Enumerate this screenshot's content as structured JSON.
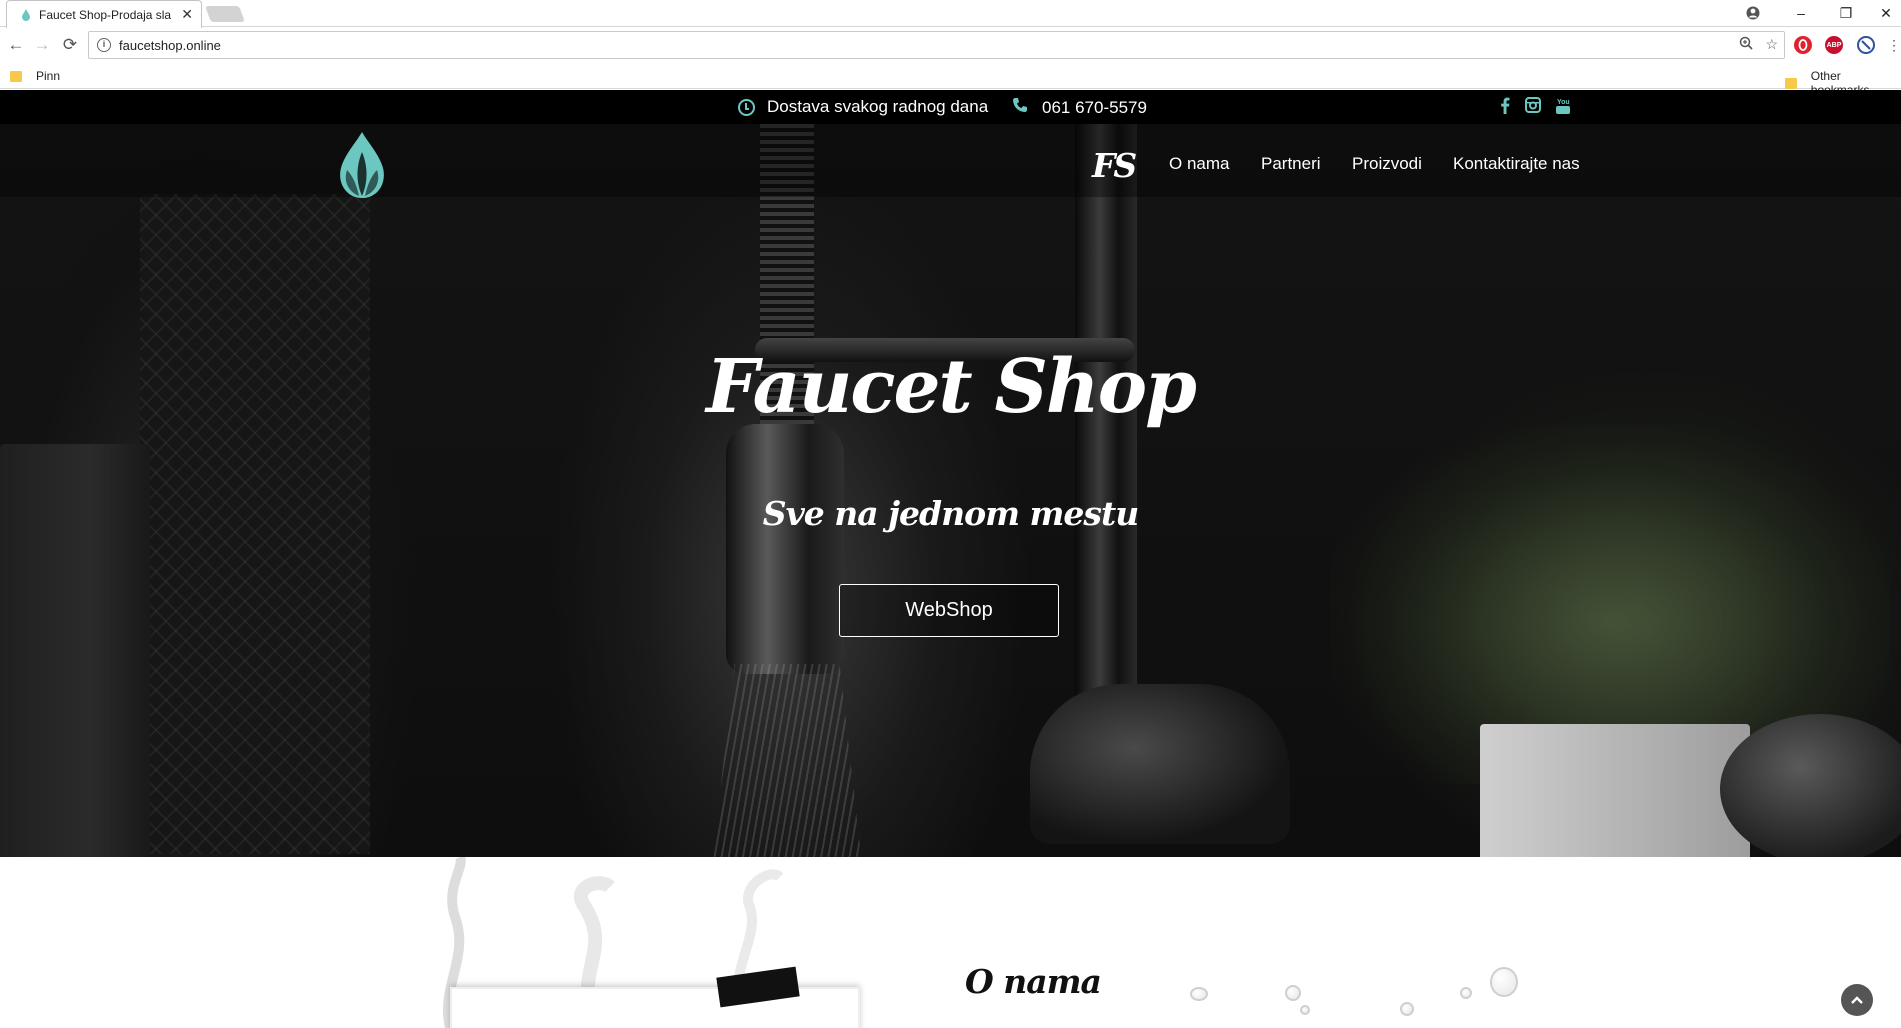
{
  "browser": {
    "tab_title": "Faucet Shop-Prodaja sla",
    "tab_close": "✕",
    "url": "faucetshop.online",
    "window_controls": [
      "–",
      "❐",
      "✕"
    ],
    "bookmarks": [
      {
        "label": "Pinn"
      },
      {
        "label": "Other bookmarks"
      }
    ],
    "extensions": [
      "opera-icon",
      "adblock-plus-icon",
      "blocker-icon"
    ],
    "abp_label": "ABP"
  },
  "topbar": {
    "delivery_text": "Dostava svakog radnog dana",
    "phone": "061 670-5579",
    "social_icons": [
      "facebook-icon",
      "instagram-icon",
      "youtube-icon"
    ],
    "accent_color": "#6cc7c1"
  },
  "nav": {
    "brand_mark": "FS",
    "links": [
      "O nama",
      "Partneri",
      "Proizvodi",
      "Kontaktirajte nas"
    ]
  },
  "hero": {
    "title": "Faucet Shop",
    "subtitle": "Sve na jednom mestu",
    "cta": "WebShop"
  },
  "about": {
    "heading": "O nama"
  }
}
